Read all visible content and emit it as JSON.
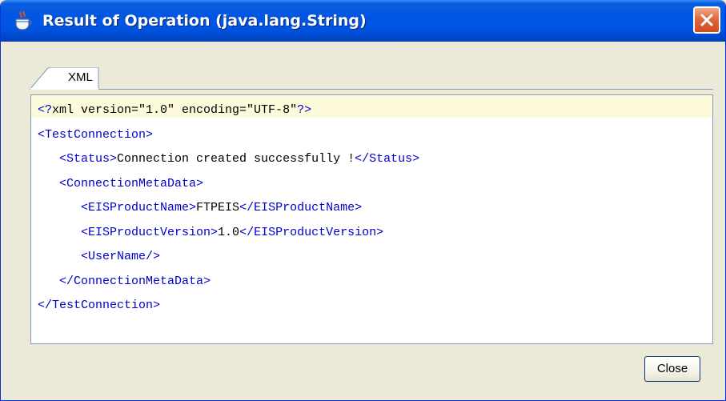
{
  "window": {
    "title": "Result of Operation (java.lang.String)",
    "colors": {
      "titlebar": "#0054e3",
      "close_button": "#e0673f",
      "tag": "#0000c8"
    }
  },
  "tabs": [
    {
      "label": "XML",
      "selected": true
    }
  ],
  "xml_lines": [
    {
      "indent": "",
      "parts": [
        {
          "t": "<?",
          "tag": true
        },
        {
          "t": "xml version=\"1.0\" encoding=\"UTF-8\"",
          "tag": false
        },
        {
          "t": "?>",
          "tag": true
        }
      ]
    },
    {
      "indent": "",
      "parts": [
        {
          "t": "<TestConnection>",
          "tag": true
        }
      ]
    },
    {
      "indent": "   ",
      "parts": [
        {
          "t": "<Status>",
          "tag": true
        },
        {
          "t": "Connection created successfully !",
          "tag": false
        },
        {
          "t": "</Status>",
          "tag": true
        }
      ]
    },
    {
      "indent": "   ",
      "parts": [
        {
          "t": "<ConnectionMetaData>",
          "tag": true
        }
      ]
    },
    {
      "indent": "      ",
      "parts": [
        {
          "t": "<EISProductName>",
          "tag": true
        },
        {
          "t": "FTPEIS",
          "tag": false
        },
        {
          "t": "</EISProductName>",
          "tag": true
        }
      ]
    },
    {
      "indent": "      ",
      "parts": [
        {
          "t": "<EISProductVersion>",
          "tag": true
        },
        {
          "t": "1.0",
          "tag": false
        },
        {
          "t": "</EISProductVersion>",
          "tag": true
        }
      ]
    },
    {
      "indent": "      ",
      "parts": [
        {
          "t": "<UserName/>",
          "tag": true
        }
      ]
    },
    {
      "indent": "   ",
      "parts": [
        {
          "t": "</ConnectionMetaData>",
          "tag": true
        }
      ]
    },
    {
      "indent": "",
      "parts": [
        {
          "t": "</TestConnection>",
          "tag": true
        }
      ]
    }
  ],
  "buttons": {
    "close_label": "Close"
  },
  "icons": {
    "app": "java-coffee-icon",
    "close": "close-icon"
  }
}
